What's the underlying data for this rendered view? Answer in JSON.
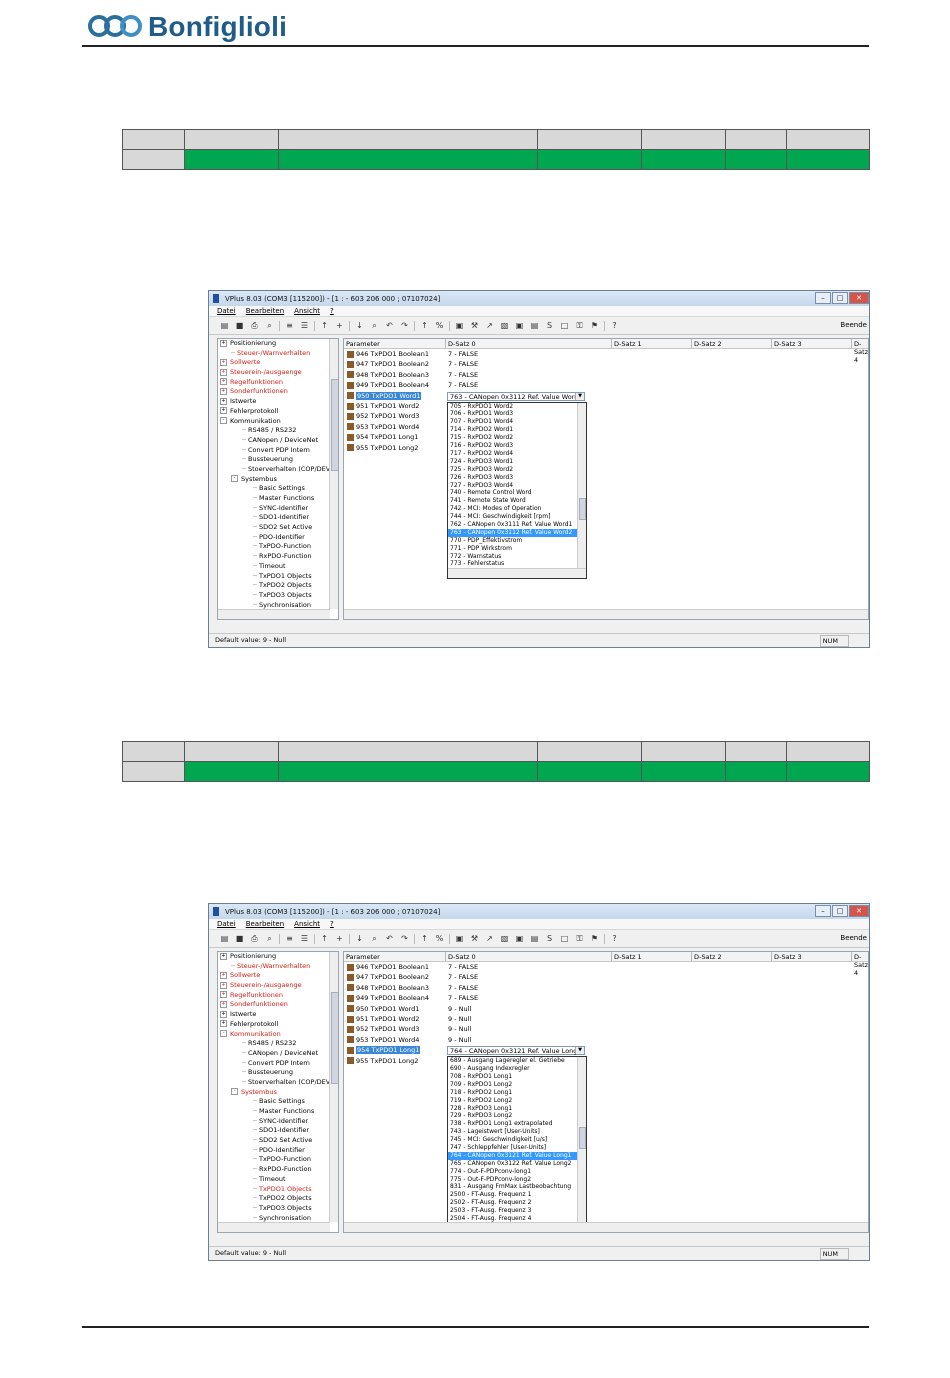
{
  "brand": {
    "name": "Bonfiglioli"
  },
  "window": {
    "title": "VPlus 8.03 (COM3 [115200]) - [1 : -  603 206 000 ; 07107024]",
    "menu": [
      "Datei",
      "Bearbeiten",
      "Ansicht",
      "?"
    ],
    "toolbar_end": "Beende",
    "columns": [
      "Parameter",
      "D-Satz 0",
      "D-Satz 1",
      "D-Satz 2",
      "D-Satz 3",
      "D-Satz 4"
    ],
    "status_left": "Default value: 9 - Null",
    "status_right": "NUM"
  },
  "screen1": {
    "tree": [
      {
        "label": "Positionierung",
        "expander": "+",
        "indent": 0,
        "red": false
      },
      {
        "label": "Steuer-/Warnverhalten",
        "expander": "",
        "indent": 1,
        "red": true
      },
      {
        "label": "Sollwerte",
        "expander": "+",
        "indent": 0,
        "red": true
      },
      {
        "label": "Steuerein-/ausgaenge",
        "expander": "+",
        "indent": 0,
        "red": true
      },
      {
        "label": "Regelfunktionen",
        "expander": "+",
        "indent": 0,
        "red": true
      },
      {
        "label": "Sonderfunktionen",
        "expander": "+",
        "indent": 0,
        "red": true
      },
      {
        "label": "Istwerte",
        "expander": "+",
        "indent": 0,
        "red": false
      },
      {
        "label": "Fehlerprotokoll",
        "expander": "+",
        "indent": 0,
        "red": false
      },
      {
        "label": "Kommunikation",
        "expander": "-",
        "indent": 0,
        "red": false
      },
      {
        "label": "RS485 / RS232",
        "expander": "",
        "indent": 2,
        "red": false
      },
      {
        "label": "CANopen / DeviceNet",
        "expander": "",
        "indent": 2,
        "red": false
      },
      {
        "label": "Convert PDP Intern",
        "expander": "",
        "indent": 2,
        "red": false
      },
      {
        "label": "Bussteuerung",
        "expander": "",
        "indent": 2,
        "red": false
      },
      {
        "label": "Stoerverhalten (COP/DEV/",
        "expander": "",
        "indent": 2,
        "red": false
      },
      {
        "label": "Systembus",
        "expander": "-",
        "indent": 1,
        "red": false
      },
      {
        "label": "Basic Settings",
        "expander": "",
        "indent": 3,
        "red": false
      },
      {
        "label": "Master Functions",
        "expander": "",
        "indent": 3,
        "red": false
      },
      {
        "label": "SYNC-Identifier",
        "expander": "",
        "indent": 3,
        "red": false
      },
      {
        "label": "SDO1-Identifier",
        "expander": "",
        "indent": 3,
        "red": false
      },
      {
        "label": "SDO2 Set Active",
        "expander": "",
        "indent": 3,
        "red": false
      },
      {
        "label": "PDO-Identifier",
        "expander": "",
        "indent": 3,
        "red": false
      },
      {
        "label": "TxPDO-Function",
        "expander": "",
        "indent": 3,
        "red": false
      },
      {
        "label": "RxPDO-Function",
        "expander": "",
        "indent": 3,
        "red": false
      },
      {
        "label": "Timeout",
        "expander": "",
        "indent": 3,
        "red": false
      },
      {
        "label": "TxPDO1 Objects",
        "expander": "",
        "indent": 3,
        "red": false
      },
      {
        "label": "TxPDO2 Objects",
        "expander": "",
        "indent": 3,
        "red": false
      },
      {
        "label": "TxPDO3 Objects",
        "expander": "",
        "indent": 3,
        "red": false
      },
      {
        "label": "Synchronisation",
        "expander": "",
        "indent": 3,
        "red": false
      }
    ],
    "params": [
      {
        "label": "946  TxPDO1 Boolean1",
        "value": "7 - FALSE",
        "selected": false
      },
      {
        "label": "947  TxPDO1 Boolean2",
        "value": "7 - FALSE",
        "selected": false
      },
      {
        "label": "948  TxPDO1 Boolean3",
        "value": "7 - FALSE",
        "selected": false
      },
      {
        "label": "949  TxPDO1 Boolean4",
        "value": "7 - FALSE",
        "selected": false
      },
      {
        "label": "950  TxPDO1 Word1",
        "value": "",
        "selected": true
      },
      {
        "label": "951  TxPDO1 Word2",
        "value": "",
        "selected": false
      },
      {
        "label": "952  TxPDO1 Word3",
        "value": "",
        "selected": false
      },
      {
        "label": "953  TxPDO1 Word4",
        "value": "",
        "selected": false
      },
      {
        "label": "954  TxPDO1 Long1",
        "value": "",
        "selected": false
      },
      {
        "label": "955  TxPDO1 Long2",
        "value": "",
        "selected": false
      }
    ],
    "combo_value": "763 - CANopen 0x3112 Ref. Value Word2",
    "dropdown": [
      "705 - RxPDO1 Word2",
      "706 - RxPDO1 Word3",
      "707 - RxPDO1 Word4",
      "714 - RxPDO2 Word1",
      "715 - RxPDO2 Word2",
      "716 - RxPDO2 Word3",
      "717 - RxPDO2 Word4",
      "724 - RxPDO3 Word1",
      "725 - RxPDO3 Word2",
      "726 - RxPDO3 Word3",
      "727 - RxPDO3 Word4",
      "740 - Remote Control Word",
      "741 - Remote State Word",
      "742 - MCI: Modes of Operation",
      "744 - MCI: Geschwindigkeit [rpm]",
      "762 - CANopen 0x3111 Ref. Value Word1",
      "763 - CANopen 0x3112 Ref. Value Word2",
      "770 - PDP_Effektivstrom",
      "771 - PDP Wirkstrom",
      "772 - Warnstatus",
      "773 - Fehlerstatus"
    ],
    "dropdown_highlight": 16
  },
  "screen2": {
    "tree": [
      {
        "label": "Positionierung",
        "expander": "+",
        "indent": 0,
        "red": false
      },
      {
        "label": "Steuer-/Warnverhalten",
        "expander": "",
        "indent": 1,
        "red": true
      },
      {
        "label": "Sollwerte",
        "expander": "+",
        "indent": 0,
        "red": true
      },
      {
        "label": "Steuerein-/ausgaenge",
        "expander": "+",
        "indent": 0,
        "red": true
      },
      {
        "label": "Regelfunktionen",
        "expander": "+",
        "indent": 0,
        "red": true
      },
      {
        "label": "Sonderfunktionen",
        "expander": "+",
        "indent": 0,
        "red": true
      },
      {
        "label": "Istwerte",
        "expander": "+",
        "indent": 0,
        "red": false
      },
      {
        "label": "Fehlerprotokoll",
        "expander": "+",
        "indent": 0,
        "red": false
      },
      {
        "label": "Kommunikation",
        "expander": "-",
        "indent": 0,
        "red": true
      },
      {
        "label": "RS485 / RS232",
        "expander": "",
        "indent": 2,
        "red": false
      },
      {
        "label": "CANopen / DeviceNet",
        "expander": "",
        "indent": 2,
        "red": false
      },
      {
        "label": "Convert PDP Intern",
        "expander": "",
        "indent": 2,
        "red": false
      },
      {
        "label": "Bussteuerung",
        "expander": "",
        "indent": 2,
        "red": false
      },
      {
        "label": "Stoerverhalten (COP/DEV/",
        "expander": "",
        "indent": 2,
        "red": false
      },
      {
        "label": "Systembus",
        "expander": "-",
        "indent": 1,
        "red": true
      },
      {
        "label": "Basic Settings",
        "expander": "",
        "indent": 3,
        "red": false
      },
      {
        "label": "Master Functions",
        "expander": "",
        "indent": 3,
        "red": false
      },
      {
        "label": "SYNC-Identifier",
        "expander": "",
        "indent": 3,
        "red": false
      },
      {
        "label": "SDO1-Identifier",
        "expander": "",
        "indent": 3,
        "red": false
      },
      {
        "label": "SDO2 Set Active",
        "expander": "",
        "indent": 3,
        "red": false
      },
      {
        "label": "PDO-Identifier",
        "expander": "",
        "indent": 3,
        "red": false
      },
      {
        "label": "TxPDO-Function",
        "expander": "",
        "indent": 3,
        "red": false
      },
      {
        "label": "RxPDO-Function",
        "expander": "",
        "indent": 3,
        "red": false
      },
      {
        "label": "Timeout",
        "expander": "",
        "indent": 3,
        "red": false
      },
      {
        "label": "TxPDO1 Objects",
        "expander": "",
        "indent": 3,
        "red": true
      },
      {
        "label": "TxPDO2 Objects",
        "expander": "",
        "indent": 3,
        "red": false
      },
      {
        "label": "TxPDO3 Objects",
        "expander": "",
        "indent": 3,
        "red": false
      },
      {
        "label": "Synchronisation",
        "expander": "",
        "indent": 3,
        "red": false
      }
    ],
    "params": [
      {
        "label": "946  TxPDO1 Boolean1",
        "value": "7 - FALSE",
        "selected": false
      },
      {
        "label": "947  TxPDO1 Boolean2",
        "value": "7 - FALSE",
        "selected": false
      },
      {
        "label": "948  TxPDO1 Boolean3",
        "value": "7 - FALSE",
        "selected": false
      },
      {
        "label": "949  TxPDO1 Boolean4",
        "value": "7 - FALSE",
        "selected": false
      },
      {
        "label": "950  TxPDO1 Word1",
        "value": "9 - Null",
        "selected": false
      },
      {
        "label": "951  TxPDO1 Word2",
        "value": "9 - Null",
        "selected": false
      },
      {
        "label": "952  TxPDO1 Word3",
        "value": "9 - Null",
        "selected": false
      },
      {
        "label": "953  TxPDO1 Word4",
        "value": "9 - Null",
        "selected": false
      },
      {
        "label": "954  TxPDO1 Long1",
        "value": "",
        "selected": true
      },
      {
        "label": "955  TxPDO1 Long2",
        "value": "",
        "selected": false
      }
    ],
    "combo_value": "764 - CANopen 0x3121 Ref. Value Long1",
    "dropdown": [
      "689 - Ausgang Lageregler el. Getriebe",
      "690 - Ausgang Indexregler",
      "708 - RxPDO1 Long1",
      "709 - RxPDO1 Long2",
      "718 - RxPDO2 Long1",
      "719 - RxPDO2 Long2",
      "728 - RxPDO3 Long1",
      "729 - RxPDO3 Long2",
      "738 - RxPDO1 Long1 extrapolated",
      "743 - Lageistwert [User-Units]",
      "745 - MCI: Geschwindigkeit [u/s]",
      "747 - Schleppfehler [User-Units]",
      "764 - CANopen 0x3121 Ref. Value Long1",
      "765 - CANopen 0x3122 Ref. Value Long2",
      "774 - Out-F-PDPconv-long1",
      "775 - Out-F-PDPconv-long2",
      "831 - Ausgang FmMax Lastbeobachtung",
      "2500 - FT-Ausg. Frequenz 1",
      "2502 - FT-Ausg. Frequenz 2",
      "2503 - FT-Ausg. Frequenz 3",
      "2504 - FT-Ausg. Frequenz 4"
    ],
    "dropdown_highlight": 12
  }
}
